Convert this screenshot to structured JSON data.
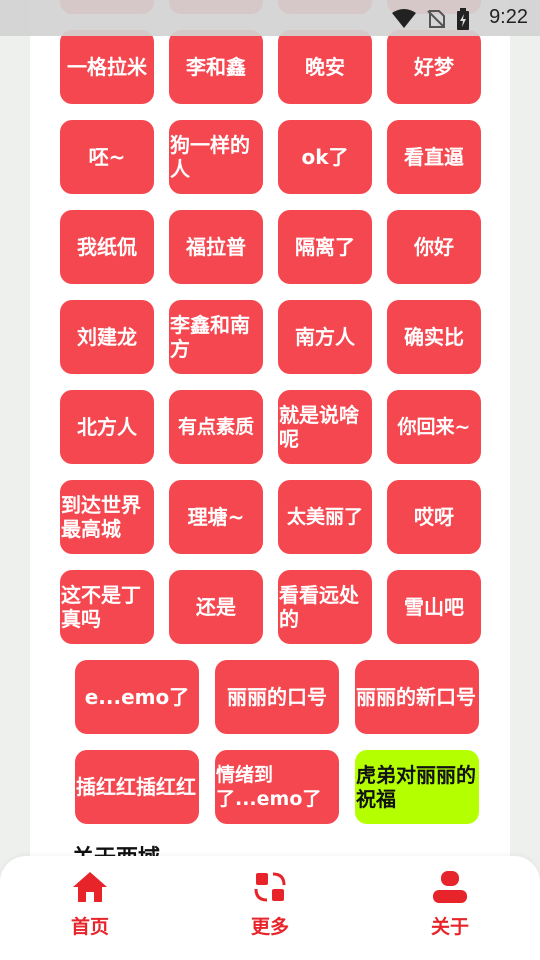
{
  "status": {
    "time": "9:22"
  },
  "grid": {
    "row1": [
      "一格拉米",
      "李和鑫",
      "晚安",
      "好梦"
    ],
    "row2": [
      "呸~",
      "狗一样的人",
      "ok了",
      "看直逼"
    ],
    "row3": [
      "我纸侃",
      "福拉普",
      "隔离了",
      "你好"
    ],
    "row4": [
      "刘建龙",
      "李鑫和南方",
      "南方人",
      "确实比"
    ],
    "row5": [
      "北方人",
      "有点素质",
      "就是说啥呢",
      "你回来~"
    ],
    "row6": [
      "到达世界最高城",
      "理塘~",
      "太美丽了",
      "哎呀"
    ],
    "row7": [
      "这不是丁真吗",
      "还是",
      "看看远处的",
      "雪山吧"
    ],
    "row8": [
      "e...emo了",
      "丽丽的口号",
      "丽丽的新口号"
    ],
    "row9": [
      "插红红插红红",
      "情绪到了...emo了",
      "虎弟对丽丽的祝福"
    ]
  },
  "section_peek": "关于西域",
  "nav": {
    "home": "首页",
    "more": "更多",
    "about": "关于"
  },
  "colors": {
    "button": "#f5474f",
    "highlight": "#b4ff00",
    "nav_accent": "#e8242b"
  }
}
